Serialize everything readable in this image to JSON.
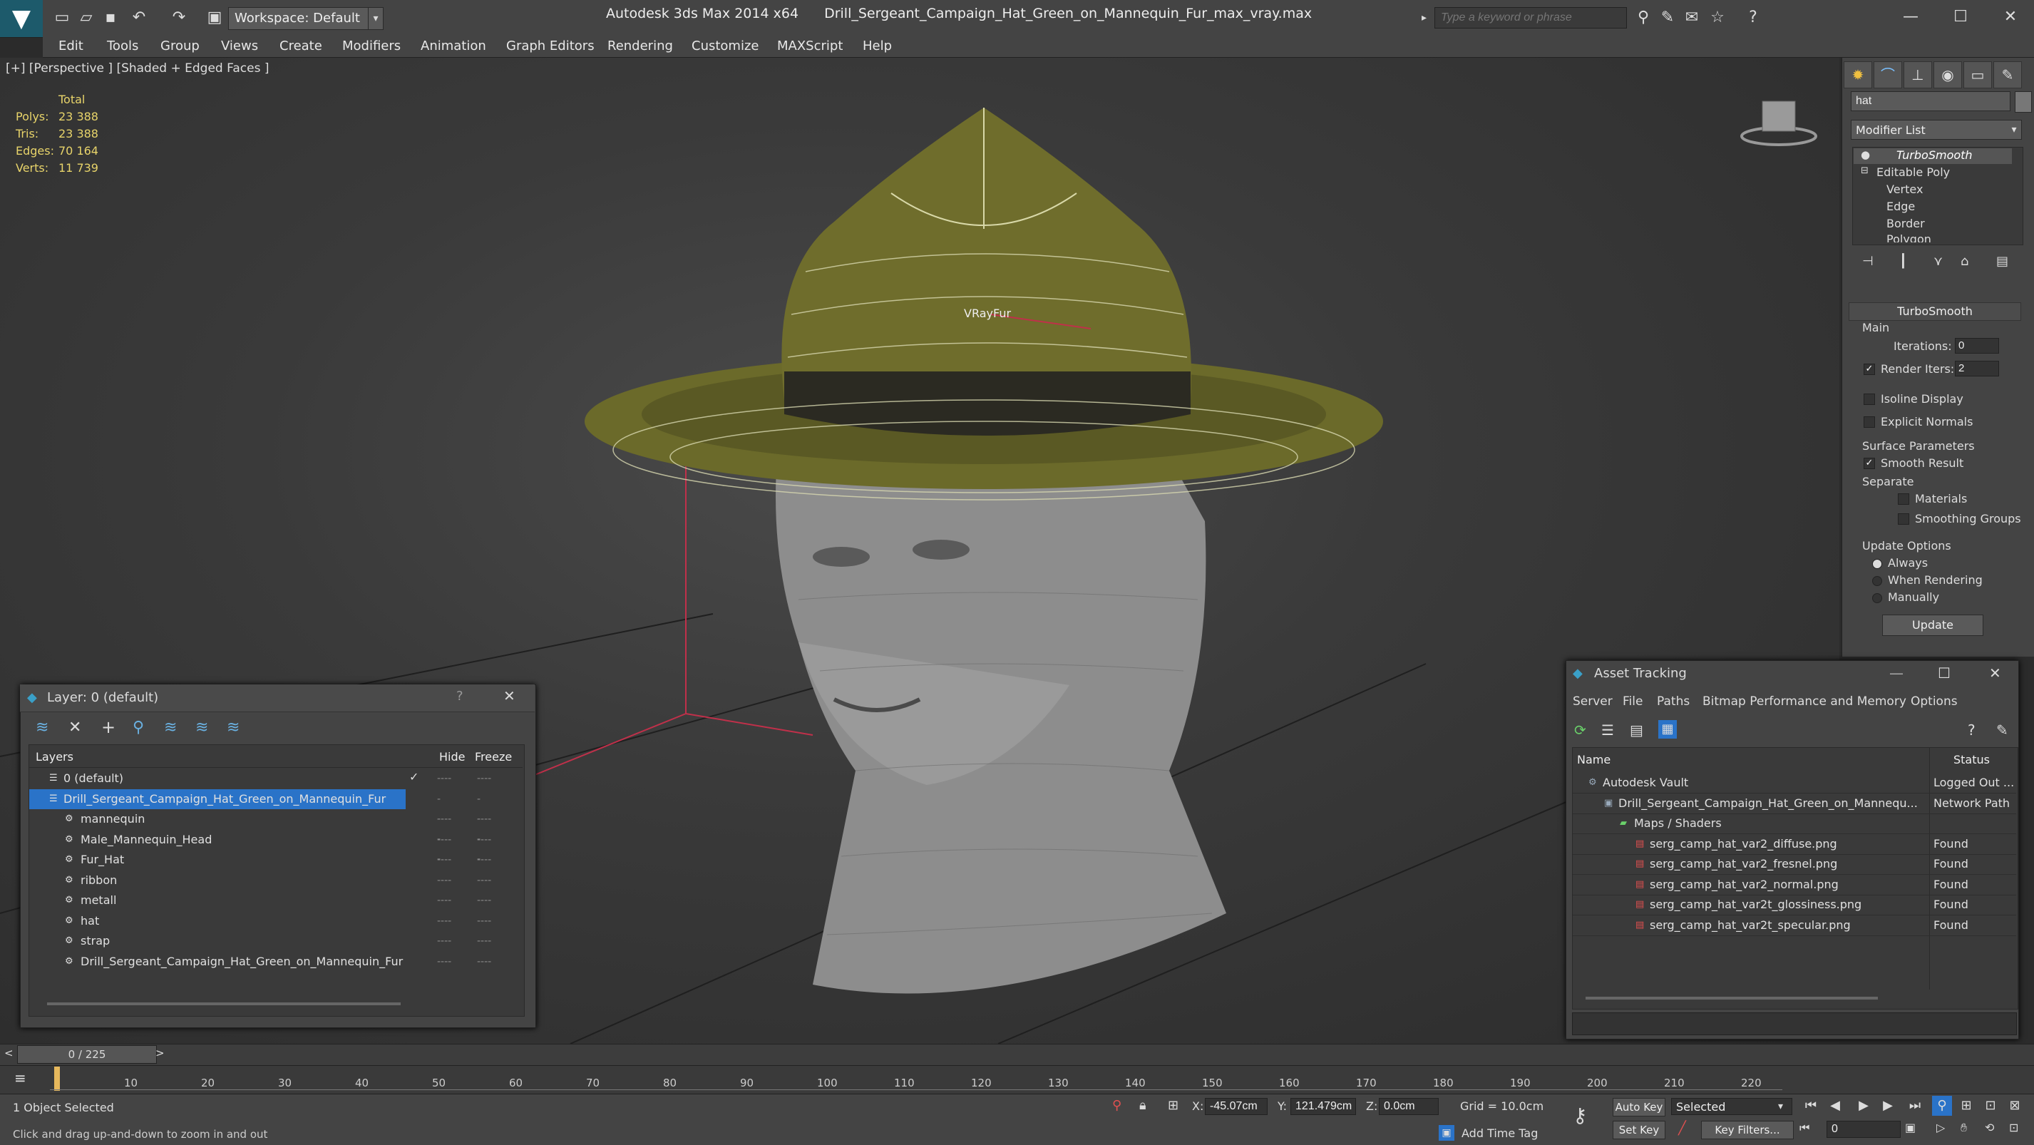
{
  "titlebar": {
    "workspace": "Workspace: Default",
    "app_name": "Autodesk 3ds Max  2014 x64",
    "file_name": "Drill_Sergeant_Campaign_Hat_Green_on_Mannequin_Fur_max_vray.max",
    "search_placeholder": "Type a keyword or phrase"
  },
  "menu": [
    "Edit",
    "Tools",
    "Group",
    "Views",
    "Create",
    "Modifiers",
    "Animation",
    "Graph Editors",
    "Rendering",
    "Customize",
    "MAXScript",
    "Help"
  ],
  "viewport": {
    "label": "[+] [Perspective ] [Shaded + Edged Faces ]",
    "stats_header": "Total",
    "stats": [
      {
        "label": "Polys:",
        "value": "23 388"
      },
      {
        "label": "Tris:",
        "value": "23 388"
      },
      {
        "label": "Edges:",
        "value": "70 164"
      },
      {
        "label": "Verts:",
        "value": "11 739"
      }
    ],
    "fur_label": "VRayFur"
  },
  "command_panel": {
    "object_name": "hat",
    "modifier_list": "Modifier List",
    "stack": [
      "TurboSmooth",
      "Editable Poly",
      "Vertex",
      "Edge",
      "Border",
      "Polygon"
    ],
    "rollout_title": "TurboSmooth",
    "main_label": "Main",
    "iterations_label": "Iterations:",
    "iterations_value": "0",
    "render_iters_label": "Render Iters:",
    "render_iters_value": "2",
    "isoline_label": "Isoline Display",
    "explicit_normals_label": "Explicit Normals",
    "surface_params_label": "Surface Parameters",
    "smooth_result_label": "Smooth Result",
    "separate_label": "Separate",
    "materials_label": "Materials",
    "smoothing_groups_label": "Smoothing Groups",
    "update_options_label": "Update Options",
    "always_label": "Always",
    "when_rendering_label": "When Rendering",
    "manually_label": "Manually",
    "update_button": "Update"
  },
  "layer_window": {
    "title": "Layer: 0 (default)",
    "col_layers": "Layers",
    "col_hide": "Hide",
    "col_freeze": "Freeze",
    "rows": [
      {
        "name": "0 (default)",
        "level": 0,
        "selected": false
      },
      {
        "name": "Drill_Sergeant_Campaign_Hat_Green_on_Mannequin_Fur",
        "level": 0,
        "selected": true
      },
      {
        "name": "mannequin",
        "level": 1,
        "selected": false
      },
      {
        "name": "Male_Mannequin_Head",
        "level": 1,
        "selected": false
      },
      {
        "name": "Fur_Hat",
        "level": 1,
        "selected": false
      },
      {
        "name": "ribbon",
        "level": 1,
        "selected": false
      },
      {
        "name": "metall",
        "level": 1,
        "selected": false
      },
      {
        "name": "hat",
        "level": 1,
        "selected": false
      },
      {
        "name": "strap",
        "level": 1,
        "selected": false
      },
      {
        "name": "Drill_Sergeant_Campaign_Hat_Green_on_Mannequin_Fur",
        "level": 1,
        "selected": false
      }
    ],
    "hide_mark": "----",
    "freeze_mark": "----"
  },
  "asset_tracking": {
    "title": "Asset Tracking",
    "menu": [
      "Server",
      "File",
      "Paths",
      "Bitmap Performance and Memory",
      "Options"
    ],
    "col_name": "Name",
    "col_status": "Status",
    "rows": [
      {
        "name": "Autodesk Vault",
        "status": "Logged Out ...",
        "level": 0
      },
      {
        "name": "Drill_Sergeant_Campaign_Hat_Green_on_Mannequ...",
        "status": "Network Path",
        "level": 1
      },
      {
        "name": "Maps / Shaders",
        "status": "",
        "level": 2
      },
      {
        "name": "serg_camp_hat_var2_diffuse.png",
        "status": "Found",
        "level": 3
      },
      {
        "name": "serg_camp_hat_var2_fresnel.png",
        "status": "Found",
        "level": 3
      },
      {
        "name": "serg_camp_hat_var2_normal.png",
        "status": "Found",
        "level": 3
      },
      {
        "name": "serg_camp_hat_var2t_glossiness.png",
        "status": "Found",
        "level": 3
      },
      {
        "name": "serg_camp_hat_var2t_specular.png",
        "status": "Found",
        "level": 3
      }
    ]
  },
  "timeline": {
    "frame_counter": "0 / 225",
    "ticks": [
      "10",
      "20",
      "30",
      "40",
      "50",
      "60",
      "70",
      "80",
      "90",
      "100",
      "110",
      "120",
      "130",
      "140",
      "150",
      "160",
      "170",
      "180",
      "190",
      "200",
      "210",
      "220"
    ]
  },
  "status_bar": {
    "selection": "1 Object Selected",
    "prompt": "Click and drag up-and-down to zoom in and out",
    "x_label": "X:",
    "x_value": "-45.07cm",
    "y_label": "Y:",
    "y_value": "121.479cm",
    "z_label": "Z:",
    "z_value": "0.0cm",
    "grid": "Grid = 10.0cm",
    "auto_key": "Auto Key",
    "selected_dropdown": "Selected",
    "set_key": "Set Key",
    "key_filters": "Key Filters...",
    "add_time_tag": "Add Time Tag",
    "frame_field": "0"
  },
  "colors": {
    "accent_selection": "#2a73c8",
    "stats_text": "#e8d46a",
    "hat_fill": "#6b6a2a"
  }
}
